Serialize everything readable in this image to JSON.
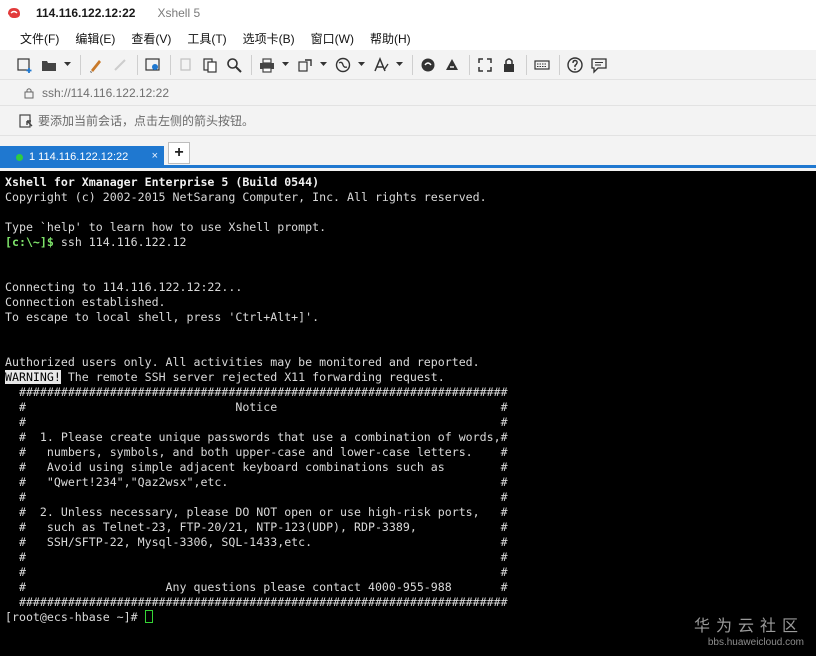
{
  "window": {
    "title": "114.116.122.12:22",
    "app_name": "Xshell 5",
    "icon": "xshell-logo-icon"
  },
  "menu": [
    {
      "label": "文件(F)"
    },
    {
      "label": "编辑(E)"
    },
    {
      "label": "查看(V)"
    },
    {
      "label": "工具(T)"
    },
    {
      "label": "选项卡(B)"
    },
    {
      "label": "窗口(W)"
    },
    {
      "label": "帮助(H)"
    }
  ],
  "toolbar": {
    "icons": [
      "new-session-icon",
      "open-folder-icon",
      "edit-icon",
      "disconnect-icon",
      "properties-icon",
      "copy-icon",
      "paste-icon",
      "find-icon",
      "print-icon",
      "transfer-icon",
      "globe-icon",
      "font-icon",
      "xftp-icon",
      "xmanager-icon",
      "fullscreen-icon",
      "lock-icon",
      "keyboard-icon",
      "help-icon",
      "chat-icon"
    ]
  },
  "address": {
    "url": "ssh://114.116.122.12:22"
  },
  "hint": {
    "text": "要添加当前会话，点击左侧的箭头按钮。"
  },
  "tabs": {
    "active": {
      "label": "1 114.116.122.12:22",
      "close": "×"
    },
    "add": "+"
  },
  "terminal": {
    "lines": [
      {
        "text": "Xshell for Xmanager Enterprise 5 (Build 0544)",
        "style": "bold"
      },
      {
        "text": "Copyright (c) 2002-2015 NetSarang Computer, Inc. All rights reserved.",
        "style": ""
      },
      {
        "text": "",
        "style": ""
      },
      {
        "text": "Type `help' to learn how to use Xshell prompt.",
        "style": ""
      },
      {
        "text": "",
        "style": "prompt-line",
        "prompt": "[c:\\~]$",
        "command": " ssh 114.116.122.12"
      },
      {
        "text": "",
        "style": ""
      },
      {
        "text": "",
        "style": ""
      },
      {
        "text": "Connecting to 114.116.122.12:22...",
        "style": ""
      },
      {
        "text": "Connection established.",
        "style": ""
      },
      {
        "text": "To escape to local shell, press 'Ctrl+Alt+]'.",
        "style": ""
      },
      {
        "text": "",
        "style": ""
      },
      {
        "text": "",
        "style": ""
      },
      {
        "text": "Authorized users only. All activities may be monitored and reported.",
        "style": ""
      },
      {
        "text": "",
        "style": "warning-line",
        "warning": "WARNING!",
        "rest": " The remote SSH server rejected X11 forwarding request."
      },
      {
        "text": "  ######################################################################",
        "style": ""
      },
      {
        "text": "  #                              Notice                                #",
        "style": ""
      },
      {
        "text": "  #                                                                    #",
        "style": ""
      },
      {
        "text": "  #  1. Please create unique passwords that use a combination of words,#",
        "style": ""
      },
      {
        "text": "  #   numbers, symbols, and both upper-case and lower-case letters.    #",
        "style": ""
      },
      {
        "text": "  #   Avoid using simple adjacent keyboard combinations such as        #",
        "style": ""
      },
      {
        "text": "  #   \"Qwert!234\",\"Qaz2wsx\",etc.                                       #",
        "style": ""
      },
      {
        "text": "  #                                                                    #",
        "style": ""
      },
      {
        "text": "  #  2. Unless necessary, please DO NOT open or use high-risk ports,   #",
        "style": ""
      },
      {
        "text": "  #   such as Telnet-23, FTP-20/21, NTP-123(UDP), RDP-3389,            #",
        "style": ""
      },
      {
        "text": "  #   SSH/SFTP-22, Mysql-3306, SQL-1433,etc.                           #",
        "style": ""
      },
      {
        "text": "  #                                                                    #",
        "style": ""
      },
      {
        "text": "  #                                                                    #",
        "style": ""
      },
      {
        "text": "  #                    Any questions please contact 4000-955-988       #",
        "style": ""
      },
      {
        "text": "  ######################################################################",
        "style": ""
      },
      {
        "text": "[root@ecs-hbase ~]# ",
        "style": "cursor-line"
      }
    ]
  },
  "watermark": {
    "main": "华为云社区",
    "sub": "bbs.huaweicloud.com"
  },
  "colors": {
    "accent": "#1f78d0",
    "terminal_bg": "#000000",
    "prompt": "#7ee36a"
  }
}
